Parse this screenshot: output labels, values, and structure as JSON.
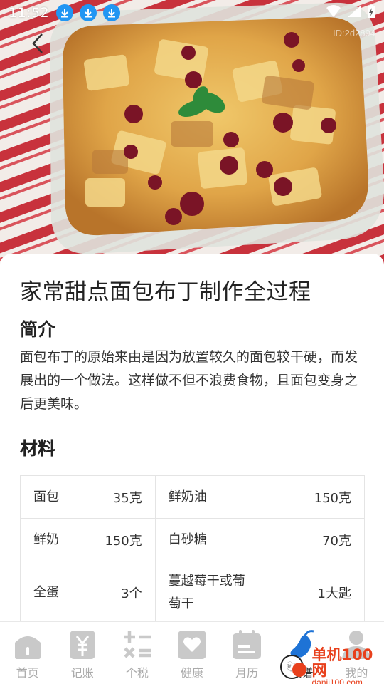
{
  "status_bar": {
    "time": "11:52",
    "download_icons": [
      "download-icon",
      "download-icon",
      "download-icon"
    ],
    "right_icons": [
      "wifi-icon",
      "signal-icon",
      "battery-charging-icon"
    ]
  },
  "hero": {
    "image": "bread-pudding-photo",
    "back_icon": "back-arrow-icon",
    "id_label": "ID:2d2894"
  },
  "recipe": {
    "title": "家常甜点面包布丁制作全过程",
    "intro_heading": "简介",
    "intro_text": "面包布丁的原始来由是因为放置较久的面包较干硬，而发展出的一个做法。这样做不但不浪费食物，且面包变身之后更美味。",
    "materials_heading": "材料",
    "materials": [
      [
        {
          "name": "面包",
          "amount": "35克"
        },
        {
          "name": "鲜奶油",
          "amount": "150克"
        }
      ],
      [
        {
          "name": "鲜奶",
          "amount": "150克"
        },
        {
          "name": "白砂糖",
          "amount": "70克"
        }
      ],
      [
        {
          "name": "全蛋",
          "amount": "3个"
        },
        {
          "name": "蔓越莓干或葡萄干",
          "amount": "1大匙"
        }
      ]
    ]
  },
  "bottom_nav": {
    "items": [
      {
        "label": "首页",
        "icon": "home-icon"
      },
      {
        "label": "记账",
        "icon": "yuan-ledger-icon"
      },
      {
        "label": "个税",
        "icon": "calculator-icon"
      },
      {
        "label": "健康",
        "icon": "heart-icon"
      },
      {
        "label": "月历",
        "icon": "calendar-icon"
      },
      {
        "label": "菜谱",
        "icon": "eggplant-icon"
      },
      {
        "label": "我的",
        "icon": "user-icon"
      }
    ],
    "active_index": 5
  },
  "watermark": {
    "cn": "单机100网",
    "en": "danji100.com",
    "logo": "danji100-logo"
  },
  "colors": {
    "status_download": "#2196f3",
    "nav_inactive": "#aaaaaa",
    "nav_active": "#1e73d6",
    "watermark": "#e8401c",
    "table_border": "#e4e4e4"
  }
}
